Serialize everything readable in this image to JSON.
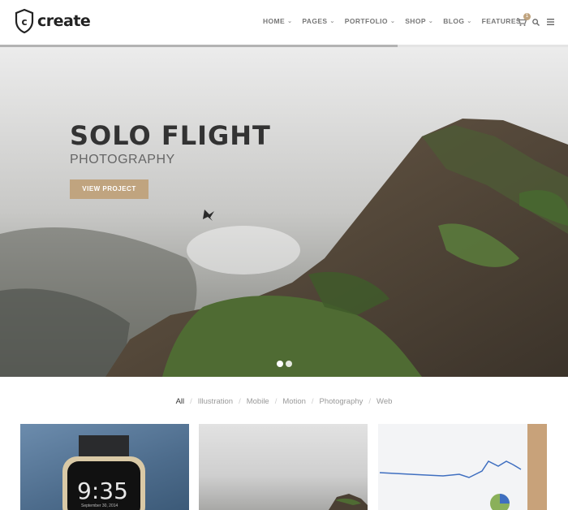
{
  "brand": {
    "name": "create"
  },
  "nav": {
    "items": [
      {
        "label": "HOME"
      },
      {
        "label": "PAGES"
      },
      {
        "label": "PORTFOLIO"
      },
      {
        "label": "SHOP"
      },
      {
        "label": "BLOG"
      },
      {
        "label": "FEATURES"
      }
    ],
    "cart_count": "1",
    "icons": [
      "cart-icon",
      "search-icon",
      "menu-icon"
    ]
  },
  "slider": {
    "progress": 0.7
  },
  "hero": {
    "title": "SOLO FLIGHT",
    "subtitle": "PHOTOGRAPHY",
    "button_label": "VIEW PROJECT",
    "slides": 2,
    "active_slide": 1
  },
  "filter": {
    "items": [
      {
        "label": "All"
      },
      {
        "label": "Illustration"
      },
      {
        "label": "Mobile"
      },
      {
        "label": "Motion"
      },
      {
        "label": "Photography"
      },
      {
        "label": "Web"
      }
    ],
    "active": "All"
  },
  "portfolio": {
    "watch_time": "9:35",
    "watch_date": "September 30, 2014"
  },
  "colors": {
    "accent": "#c0a47f",
    "text_dark": "#333333",
    "nav_text": "#777777"
  }
}
